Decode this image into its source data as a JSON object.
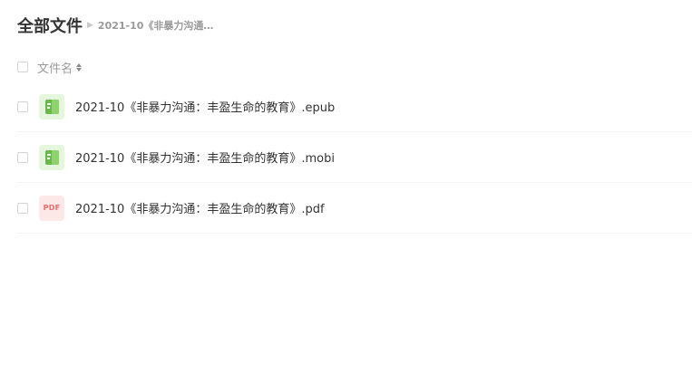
{
  "breadcrumb": {
    "root": "全部文件",
    "current": "2021-10《非暴力沟通…"
  },
  "list": {
    "header": {
      "name_label": "文件名"
    },
    "files": [
      {
        "name": "2021-10《非暴力沟通：丰盈生命的教育》.epub",
        "icon": "book-icon"
      },
      {
        "name": "2021-10《非暴力沟通：丰盈生命的教育》.mobi",
        "icon": "book-icon"
      },
      {
        "name": "2021-10《非暴力沟通：丰盈生命的教育》.pdf",
        "icon": "pdf-icon",
        "icon_text": "PDF"
      }
    ]
  },
  "colors": {
    "book_icon_bg": "#e6f5dd",
    "book_icon_fg": "#67b94b",
    "pdf_icon_bg": "#fde8e8",
    "pdf_icon_fg": "#f06a6a",
    "text": "#333333",
    "muted": "#999999"
  }
}
